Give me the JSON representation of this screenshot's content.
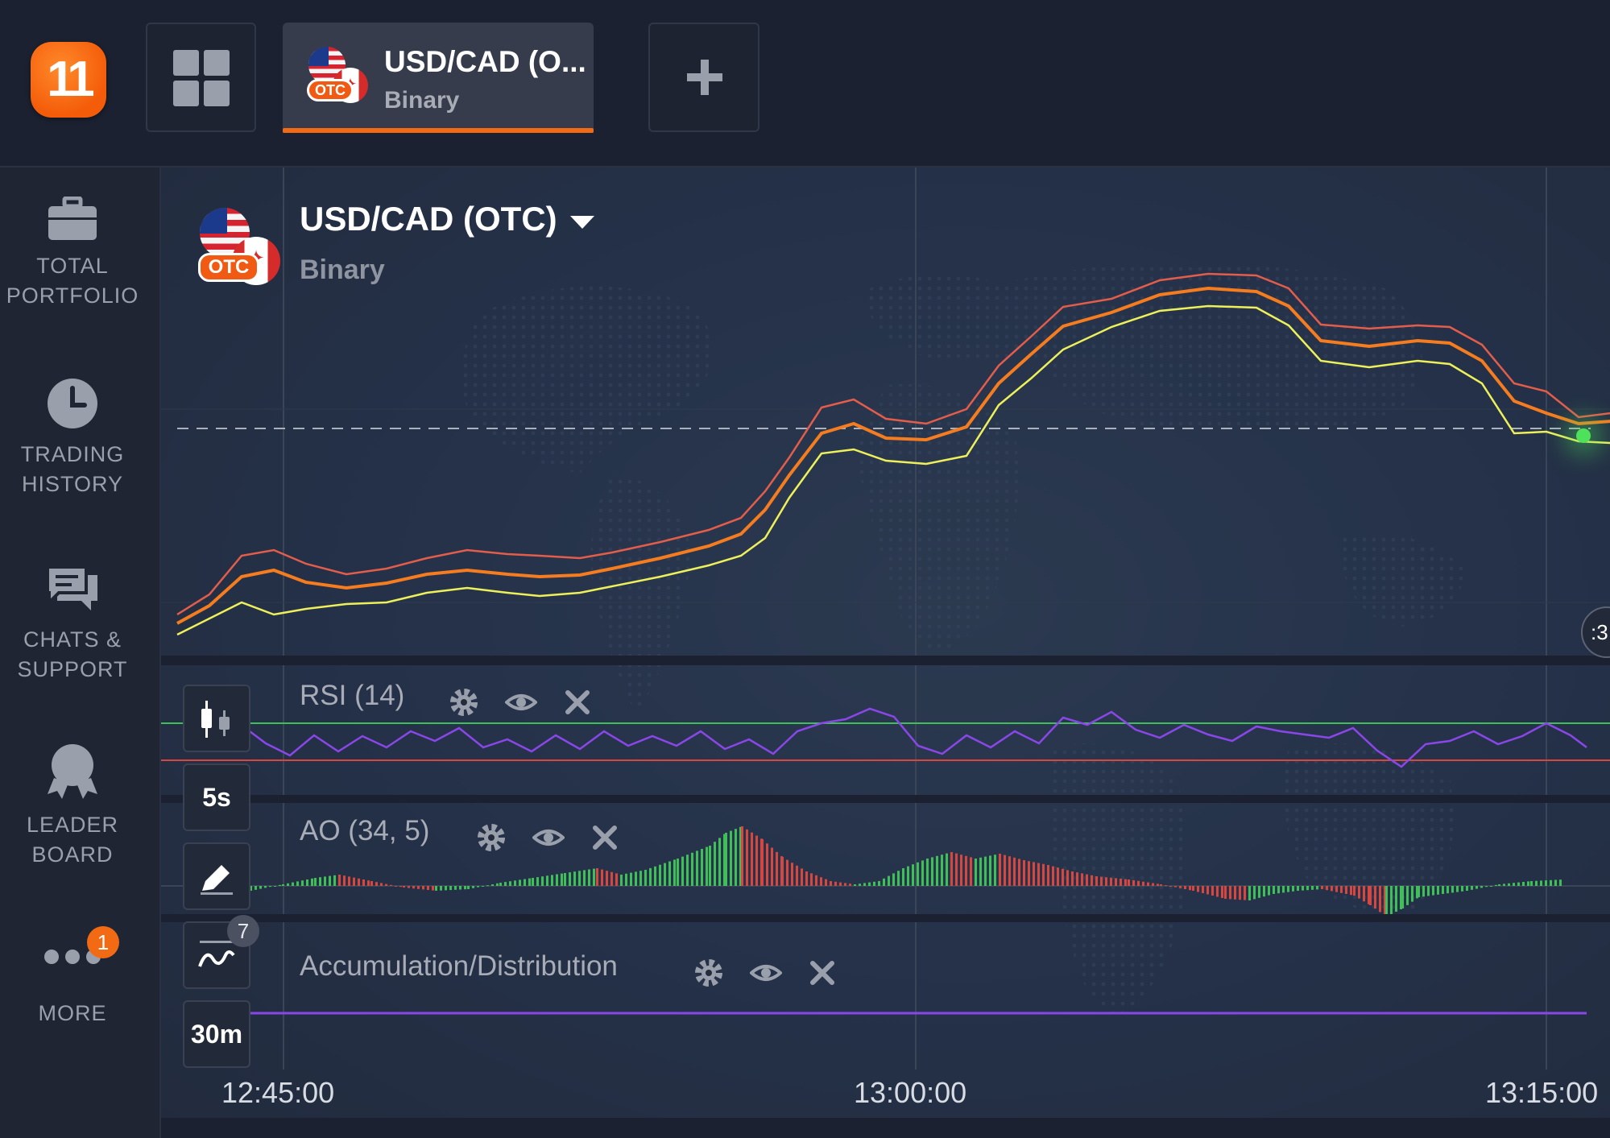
{
  "header": {
    "logo_text": "11",
    "tab": {
      "title": "USD/CAD (O...",
      "subtitle": "Binary",
      "flag_badge": "OTC"
    }
  },
  "sidebar": {
    "items": [
      {
        "line1": "TOTAL",
        "line2": "PORTFOLIO"
      },
      {
        "line1": "TRADING",
        "line2": "HISTORY"
      },
      {
        "line1": "CHATS &",
        "line2": "SUPPORT"
      },
      {
        "line1": "LEADER",
        "line2": "BOARD"
      },
      {
        "line1": "MORE",
        "line2": ""
      }
    ],
    "more_badge": "1"
  },
  "chart": {
    "asset": {
      "name": "USD/CAD (OTC)",
      "type": "Binary",
      "flag_badge": "OTC"
    },
    "indicators": [
      {
        "label": "RSI (14)"
      },
      {
        "label": "AO (34, 5)"
      },
      {
        "label": "Accumulation/Distribution"
      }
    ],
    "tools": {
      "timeframe": "5s",
      "period": "30m",
      "indicator_count": "7"
    },
    "time_axis": [
      "12:45:00",
      "13:00:00",
      "13:15:00"
    ],
    "right_clip_text": ":3",
    "colors": {
      "accent": "#f26a14",
      "price": "#f57c1f",
      "upper_band": "#e35d4b",
      "lower_band": "#eef05a",
      "rsi": "#8a47e8",
      "ao_up": "#3fbf58",
      "ao_down": "#d7473f",
      "live": "#4ee25a"
    }
  }
}
